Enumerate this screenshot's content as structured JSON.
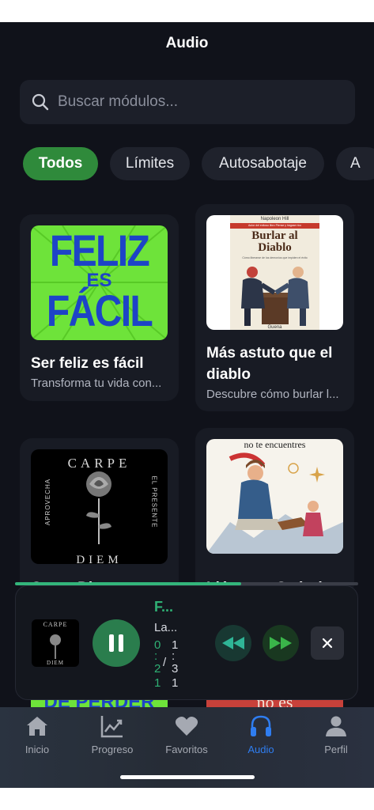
{
  "header": {
    "title": "Audio"
  },
  "search": {
    "placeholder": "Buscar módulos..."
  },
  "chips": [
    "Todos",
    "Límites",
    "Autosabotaje",
    "A"
  ],
  "cards": [
    {
      "title": "Ser feliz es fácil",
      "subtitle": "Transforma tu vida con...",
      "cover_text": [
        "FELIZ",
        "ES",
        "FÁCIL"
      ]
    },
    {
      "title": "Más astuto que el diablo",
      "subtitle": "Descubre cómo burlar l...",
      "cover_author": "Napoleon Hill",
      "cover_tagline": "Autor del exitoso libro Piense y hágase rico",
      "cover_title": "Burlar al Diablo",
      "cover_subtitle": "Cómo liberarse de los demonios que impiden el éxito",
      "cover_bottom": "Guena"
    },
    {
      "title": "Carpe Diem",
      "subtitle": "",
      "cover_top": "CARPE",
      "cover_left": "APROVECHA",
      "cover_right": "EL PRESENTE",
      "cover_bottom": "DIEM"
    },
    {
      "title": "Llámame Cuándo",
      "subtitle": "",
      "cover_text": "no te encuentres"
    }
  ],
  "peek": {
    "left": "DE PERDER",
    "right": "no es"
  },
  "player": {
    "title": "F...",
    "artist": "La...",
    "progress": 0.66,
    "time_current": [
      "0",
      ":",
      "2",
      "1"
    ],
    "time_sep": "/",
    "time_total": [
      "1",
      ":",
      "3",
      "1"
    ],
    "thumb_top": "CARPE",
    "thumb_bottom": "DIEM"
  },
  "tabs": [
    {
      "label": "Inicio",
      "icon": "home-icon",
      "active": false
    },
    {
      "label": "Progreso",
      "icon": "chart-icon",
      "active": false
    },
    {
      "label": "Favoritos",
      "icon": "heart-icon",
      "active": false
    },
    {
      "label": "Audio",
      "icon": "headphones-icon",
      "active": true
    },
    {
      "label": "Perfil",
      "icon": "person-icon",
      "active": false
    }
  ],
  "colors": {
    "accent": "#2f8a3b",
    "player_accent": "#33b57b",
    "tab_active": "#2f7df0",
    "background": "#10121a"
  }
}
